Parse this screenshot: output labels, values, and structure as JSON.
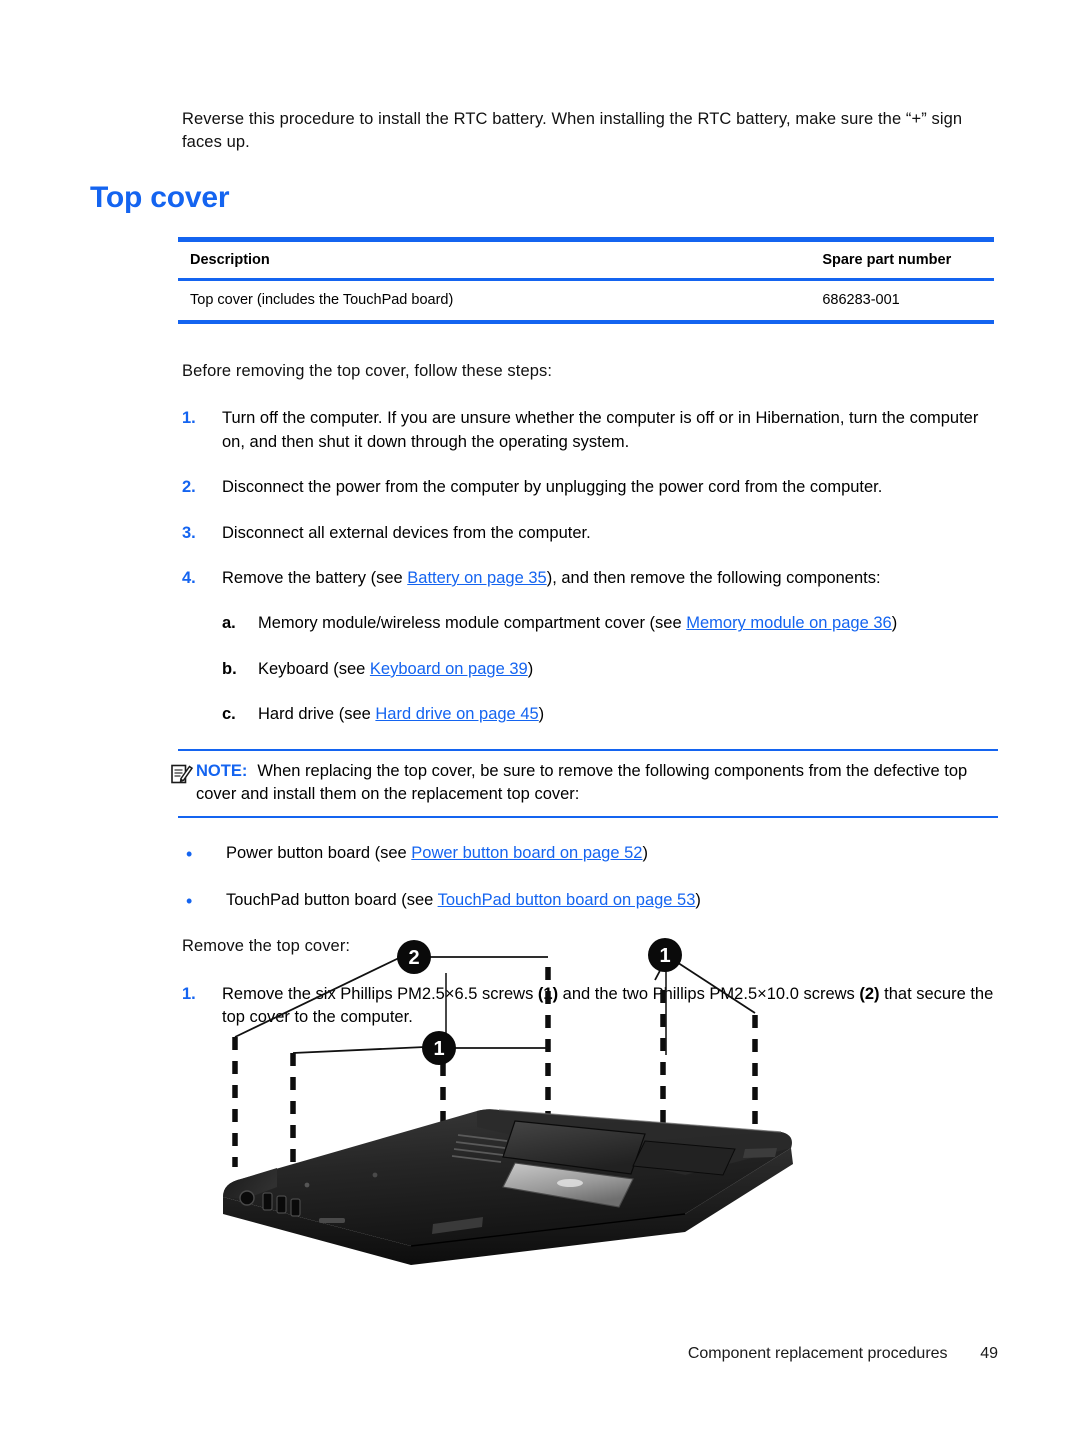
{
  "document": {
    "intro_paragraph": "Reverse this procedure to install the RTC battery. When installing the RTC battery, make sure the “+” sign faces up.",
    "section_heading": "Top cover"
  },
  "parts_table": {
    "headers": {
      "description": "Description",
      "spare_part_number": "Spare part number"
    },
    "rows": [
      {
        "description": "Top cover (includes the TouchPad board)",
        "spare_part_number": "686283-001"
      }
    ]
  },
  "before_section": {
    "lead_in": "Before removing the top cover, follow these steps:",
    "steps": [
      {
        "number": "1.",
        "text": "Turn off the computer. If you are unsure whether the computer is off or in Hibernation, turn the computer on, and then shut it down through the operating system."
      },
      {
        "number": "2.",
        "text": "Disconnect the power from the computer by unplugging the power cord from the computer."
      },
      {
        "number": "3.",
        "text": "Disconnect all external devices from the computer."
      }
    ],
    "step4": {
      "number": "4.",
      "text_before": "Remove the battery (see ",
      "link": "Battery on page 35",
      "text_after": "), and then remove the following components:"
    },
    "substeps": [
      {
        "number": "a.",
        "text_before": "Memory module/wireless module compartment cover (see ",
        "link": "Memory module on page 36",
        "text_after": ")"
      },
      {
        "number": "b.",
        "text_before": "Keyboard (see ",
        "link": "Keyboard on page 39",
        "text_after": ")"
      },
      {
        "number": "c.",
        "text_before": "Hard drive (see ",
        "link": "Hard drive on page 45",
        "text_after": ")"
      }
    ]
  },
  "note": {
    "icon": "note-clipboard-icon",
    "label": "NOTE:",
    "text": "When replacing the top cover, be sure to remove the following components from the defective top cover and install them on the replacement top cover:",
    "bullet_marker": "•",
    "bullets": [
      {
        "text_before": "Power button board (see ",
        "link": "Power button board on page 52",
        "text_after": ")"
      },
      {
        "text_before": "TouchPad button board (see ",
        "link": "TouchPad button board on page 53",
        "text_after": ")"
      }
    ]
  },
  "remove_section": {
    "lead_in": "Remove the top cover:",
    "step1": {
      "number": "1.",
      "part1": "Remove the six Phillips PM2.5×6.5 screws ",
      "callout1": "(1)",
      "part2": " and the two Phillips PM2.5×10.0 screws ",
      "callout2": "(2)",
      "part3": " that secure the top cover to the computer."
    }
  },
  "illustration": {
    "alt": "Bottom view of laptop showing screw callout locations",
    "callouts": [
      {
        "label": "2"
      },
      {
        "label": "1"
      },
      {
        "label": "1"
      }
    ]
  },
  "footer": {
    "chapter_title": "Component replacement procedures",
    "page_number": "49"
  },
  "colors": {
    "accent_blue": "#1464f0",
    "text_black": "#111111",
    "device_black": "#201f1f"
  }
}
